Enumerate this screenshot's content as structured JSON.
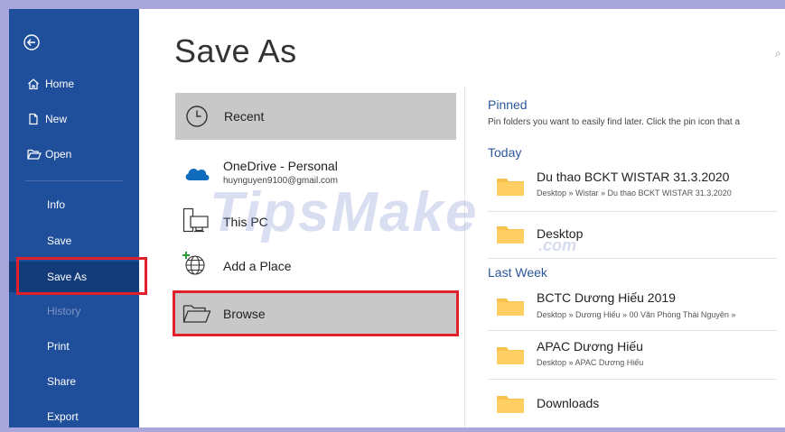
{
  "page_title": "Save As",
  "search_hint": "⌕",
  "sidebar": {
    "items": [
      {
        "label": "Home"
      },
      {
        "label": "New"
      },
      {
        "label": "Open"
      },
      {
        "label": "Info"
      },
      {
        "label": "Save"
      },
      {
        "label": "Save As"
      },
      {
        "label": "History"
      },
      {
        "label": "Print"
      },
      {
        "label": "Share"
      },
      {
        "label": "Export"
      }
    ]
  },
  "locations": {
    "recent": "Recent",
    "onedrive": {
      "label": "OneDrive - Personal",
      "account": "huynguyen9100@gmail.com"
    },
    "this_pc": "This PC",
    "add_place": "Add a Place",
    "browse": "Browse"
  },
  "pinned": {
    "heading": "Pinned",
    "hint": "Pin folders you want to easily find later. Click the pin icon that a"
  },
  "today": {
    "heading": "Today",
    "folders": [
      {
        "name": "Du thao BCKT WISTAR  31.3.2020",
        "path": "Desktop » Wistar » Du thao BCKT WISTAR  31.3.2020"
      },
      {
        "name": "Desktop",
        "path": ""
      }
    ]
  },
  "last_week": {
    "heading": "Last Week",
    "folders": [
      {
        "name": "BCTC Dương Hiếu 2019",
        "path": "Desktop » Dương Hiếu » 00 Văn Phòng Thái Nguyên »"
      },
      {
        "name": "APAC Dương Hiếu",
        "path": "Desktop » APAC Dương Hiếu"
      },
      {
        "name": "Downloads",
        "path": ""
      }
    ]
  },
  "watermark": {
    "text": "TipsMake",
    "suffix": ".com"
  },
  "colors": {
    "sidebar": "#1f4e9b",
    "highlight": "#e0202a",
    "accent": "#2b579a",
    "folder": "#f6c24d"
  }
}
